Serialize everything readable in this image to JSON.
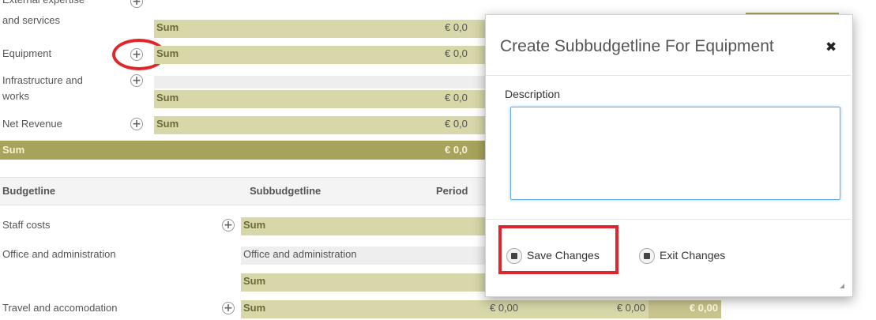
{
  "top_table": {
    "rows": [
      {
        "label_line1": "External expertise",
        "label_line2": "and services",
        "sub": "Sum",
        "value": "€ 0,0"
      },
      {
        "label": "Equipment",
        "sub": "Sum",
        "value": "€ 0,0"
      },
      {
        "label_line1": "Infrastructure and",
        "label_line2": "works",
        "sub": "Sum",
        "value": "€ 0,0"
      },
      {
        "label": "Net Revenue",
        "sub": "Sum",
        "value": "€ 0,0"
      }
    ],
    "total": {
      "label": "Sum",
      "value": "€ 0,0"
    }
  },
  "bottom_table": {
    "headers": {
      "budgetline": "Budgetline",
      "subbudgetline": "Subbudgetline",
      "period": "Period"
    },
    "rows": [
      {
        "budgetline": "Staff costs",
        "sub": "Sum"
      },
      {
        "budgetline": "Office and administration",
        "sub": "Office and administration"
      },
      {
        "budgetline": "",
        "sub": "Sum"
      },
      {
        "budgetline": "Travel and accomodation",
        "sub": "Sum",
        "v1": "€ 0,00",
        "v2": "€ 0,00",
        "v3": "€ 0,00"
      }
    ]
  },
  "modal": {
    "title": "Create Subbudgetline For Equipment",
    "close_symbol": "✖",
    "field_label": "Description",
    "description_value": "",
    "save_label": "Save Changes",
    "exit_label": "Exit Changes"
  },
  "colors": {
    "olive_light": "#d7d7a9",
    "olive_dark": "#a8a35c",
    "highlight_red": "#e0262b"
  }
}
